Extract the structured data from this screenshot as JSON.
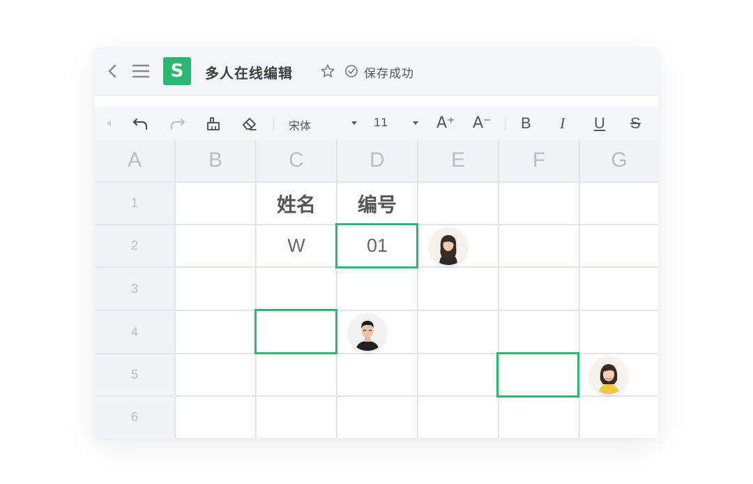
{
  "titlebar": {
    "title": "多人在线编辑",
    "save_status": "保存成功",
    "app_logo": "S"
  },
  "toolbar": {
    "font_name": "宋体",
    "font_size": "11",
    "increase_font": "A⁺",
    "decrease_font": "A⁻",
    "bold": "B",
    "italic": "I",
    "underline": "U",
    "strikethrough": "S"
  },
  "sheet": {
    "columns": [
      "A",
      "B",
      "C",
      "D",
      "E",
      "F",
      "G"
    ],
    "rows": [
      "1",
      "2",
      "3",
      "4",
      "5",
      "6"
    ],
    "cells": {
      "C1": "姓名",
      "D1": "编号",
      "C2": "W",
      "D2": "01"
    }
  },
  "colors": {
    "accent": "#2bb673",
    "header_bg": "#f2f3f6",
    "grid_line": "#e2e4e9"
  },
  "collaborators": [
    {
      "name": "avatar-woman-long-hair",
      "cell": "D2"
    },
    {
      "name": "avatar-man",
      "cell": "C4"
    },
    {
      "name": "avatar-woman-yellow",
      "cell": "F5"
    }
  ]
}
